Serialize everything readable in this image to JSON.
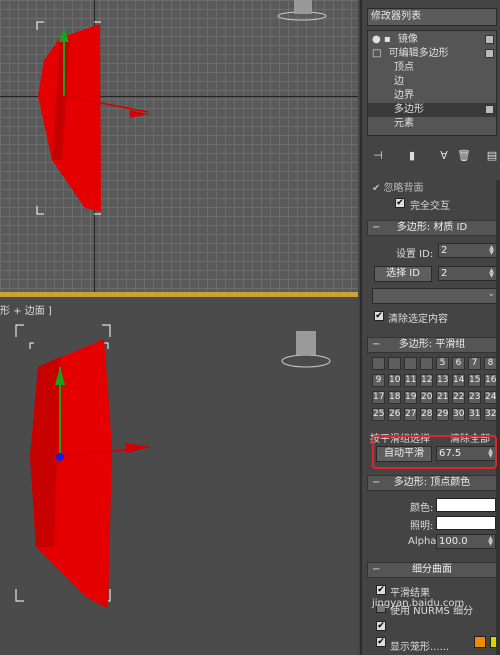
{
  "viewport_bottom": {
    "label": "形 + 边面 ]"
  },
  "modifier_list": {
    "field": "修改器列表"
  },
  "stack": [
    {
      "label": "镜像",
      "indent": 0,
      "prefix": "● ▪"
    },
    {
      "label": "可编辑多边形",
      "indent": 0,
      "prefix": "□"
    },
    {
      "label": "顶点",
      "indent": 1,
      "prefix": ""
    },
    {
      "label": "边",
      "indent": 1,
      "prefix": ""
    },
    {
      "label": "边界",
      "indent": 1,
      "prefix": ""
    },
    {
      "label": "多边形",
      "indent": 1,
      "prefix": "",
      "selected": true
    },
    {
      "label": "元素",
      "indent": 1,
      "prefix": ""
    }
  ],
  "toolbar": {
    "icons": [
      "pin-icon",
      "stack-icon",
      "unique-icon",
      "remove-icon",
      "configure-icon"
    ]
  },
  "partial_row": "✔ 忽略背面",
  "full_interaction": "完全交互",
  "material_id": {
    "title": "多边形: 材质 ID",
    "set_id_label": "设置 ID:",
    "set_id_value": "2",
    "select_id_button": "选择 ID",
    "select_id_value": "2",
    "clear_selection": "清除选定内容"
  },
  "smoothing": {
    "title": "多边形: 平滑组",
    "groups": [
      "",
      "",
      "",
      "",
      "",
      "",
      "",
      "",
      "",
      "",
      "",
      "5",
      "6",
      "7",
      "8",
      "9",
      "10",
      "11",
      "12",
      "13",
      "14",
      "15",
      "16",
      "17",
      "18",
      "19",
      "20",
      "21",
      "22",
      "23",
      "24",
      "25",
      "26",
      "27",
      "28",
      "29",
      "30",
      "31",
      "32"
    ],
    "select_by_sg": "按平滑组选择",
    "clear_all": "清除全部",
    "auto_smooth_button": "自动平滑",
    "auto_smooth_value": "67.5"
  },
  "vertex_colors": {
    "title": "多边形: 顶点颜色",
    "color_label": "颜色:",
    "illum_label": "照明:",
    "alpha_label": "Alpha:",
    "alpha_value": "100.0"
  },
  "subdivision": {
    "title": "细分曲面",
    "smooth_result": "平滑结果",
    "use_nurms": "使用 NURMS 细分",
    "show_cage": "显示笼形......"
  },
  "watermark": "jingyan.baidu.com",
  "colors": {
    "mesh": "#e40000",
    "highlight": "#e0262b",
    "panel": "#444444"
  }
}
